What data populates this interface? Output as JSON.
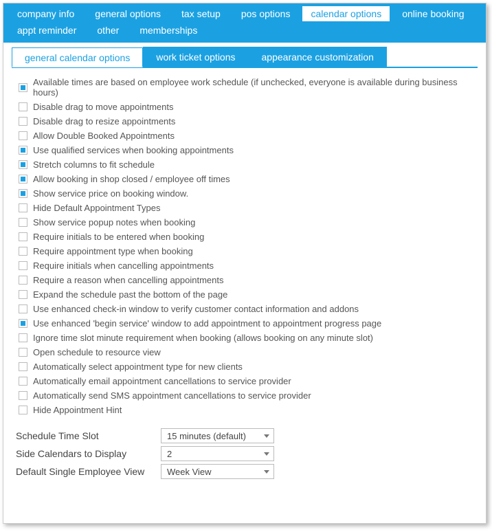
{
  "topnav": [
    {
      "id": "company-info",
      "label": "company info",
      "active": false
    },
    {
      "id": "general-options",
      "label": "general options",
      "active": false
    },
    {
      "id": "tax-setup",
      "label": "tax setup",
      "active": false
    },
    {
      "id": "pos-options",
      "label": "pos options",
      "active": false
    },
    {
      "id": "calendar-options",
      "label": "calendar options",
      "active": true
    },
    {
      "id": "online-booking",
      "label": "online booking",
      "active": false
    },
    {
      "id": "appt-reminder",
      "label": "appt reminder",
      "active": false
    },
    {
      "id": "other",
      "label": "other",
      "active": false
    },
    {
      "id": "memberships",
      "label": "memberships",
      "active": false
    }
  ],
  "subtabs": [
    {
      "id": "general-calendar-options",
      "label": "general calendar options",
      "active": true
    },
    {
      "id": "work-ticket-options",
      "label": "work ticket options",
      "active": false
    },
    {
      "id": "appearance-customization",
      "label": "appearance customization",
      "active": false
    }
  ],
  "checks": [
    {
      "checked": true,
      "label": "Available times are based on employee work schedule (if unchecked, everyone is available during business hours)"
    },
    {
      "checked": false,
      "label": "Disable drag to move appointments"
    },
    {
      "checked": false,
      "label": "Disable drag to resize appointments"
    },
    {
      "checked": false,
      "label": "Allow Double Booked Appointments"
    },
    {
      "checked": true,
      "label": "Use qualified services when booking appointments"
    },
    {
      "checked": true,
      "label": "Stretch columns to fit schedule"
    },
    {
      "checked": true,
      "label": "Allow booking in shop closed / employee off times"
    },
    {
      "checked": true,
      "label": "Show service price on booking window."
    },
    {
      "checked": false,
      "label": "Hide Default Appointment Types"
    },
    {
      "checked": false,
      "label": "Show service popup notes when booking"
    },
    {
      "checked": false,
      "label": "Require initials to be entered when booking"
    },
    {
      "checked": false,
      "label": "Require appointment type when booking"
    },
    {
      "checked": false,
      "label": "Require initials when cancelling appointments"
    },
    {
      "checked": false,
      "label": "Require a reason when cancelling appointments"
    },
    {
      "checked": false,
      "label": "Expand the schedule past the bottom of the page"
    },
    {
      "checked": false,
      "label": "Use enhanced check-in window to verify customer contact information and addons"
    },
    {
      "checked": true,
      "label": "Use enhanced 'begin service' window to add appointment to appointment progress page"
    },
    {
      "checked": false,
      "label": "Ignore time slot minute requirement when booking (allows booking on any minute slot)"
    },
    {
      "checked": false,
      "label": "Open schedule to resource view"
    },
    {
      "checked": false,
      "label": "Automatically select appointment type for new clients"
    },
    {
      "checked": false,
      "label": "Automatically email appointment cancellations to service provider"
    },
    {
      "checked": false,
      "label": "Automatically send SMS appointment cancellations to service provider"
    },
    {
      "checked": false,
      "label": "Hide Appointment Hint"
    }
  ],
  "form": {
    "time_slot": {
      "label": "Schedule Time Slot",
      "value": "15 minutes (default)"
    },
    "side_cal": {
      "label": "Side Calendars to Display",
      "value": "2"
    },
    "default_view": {
      "label": "Default Single Employee View",
      "value": "Week View"
    }
  }
}
